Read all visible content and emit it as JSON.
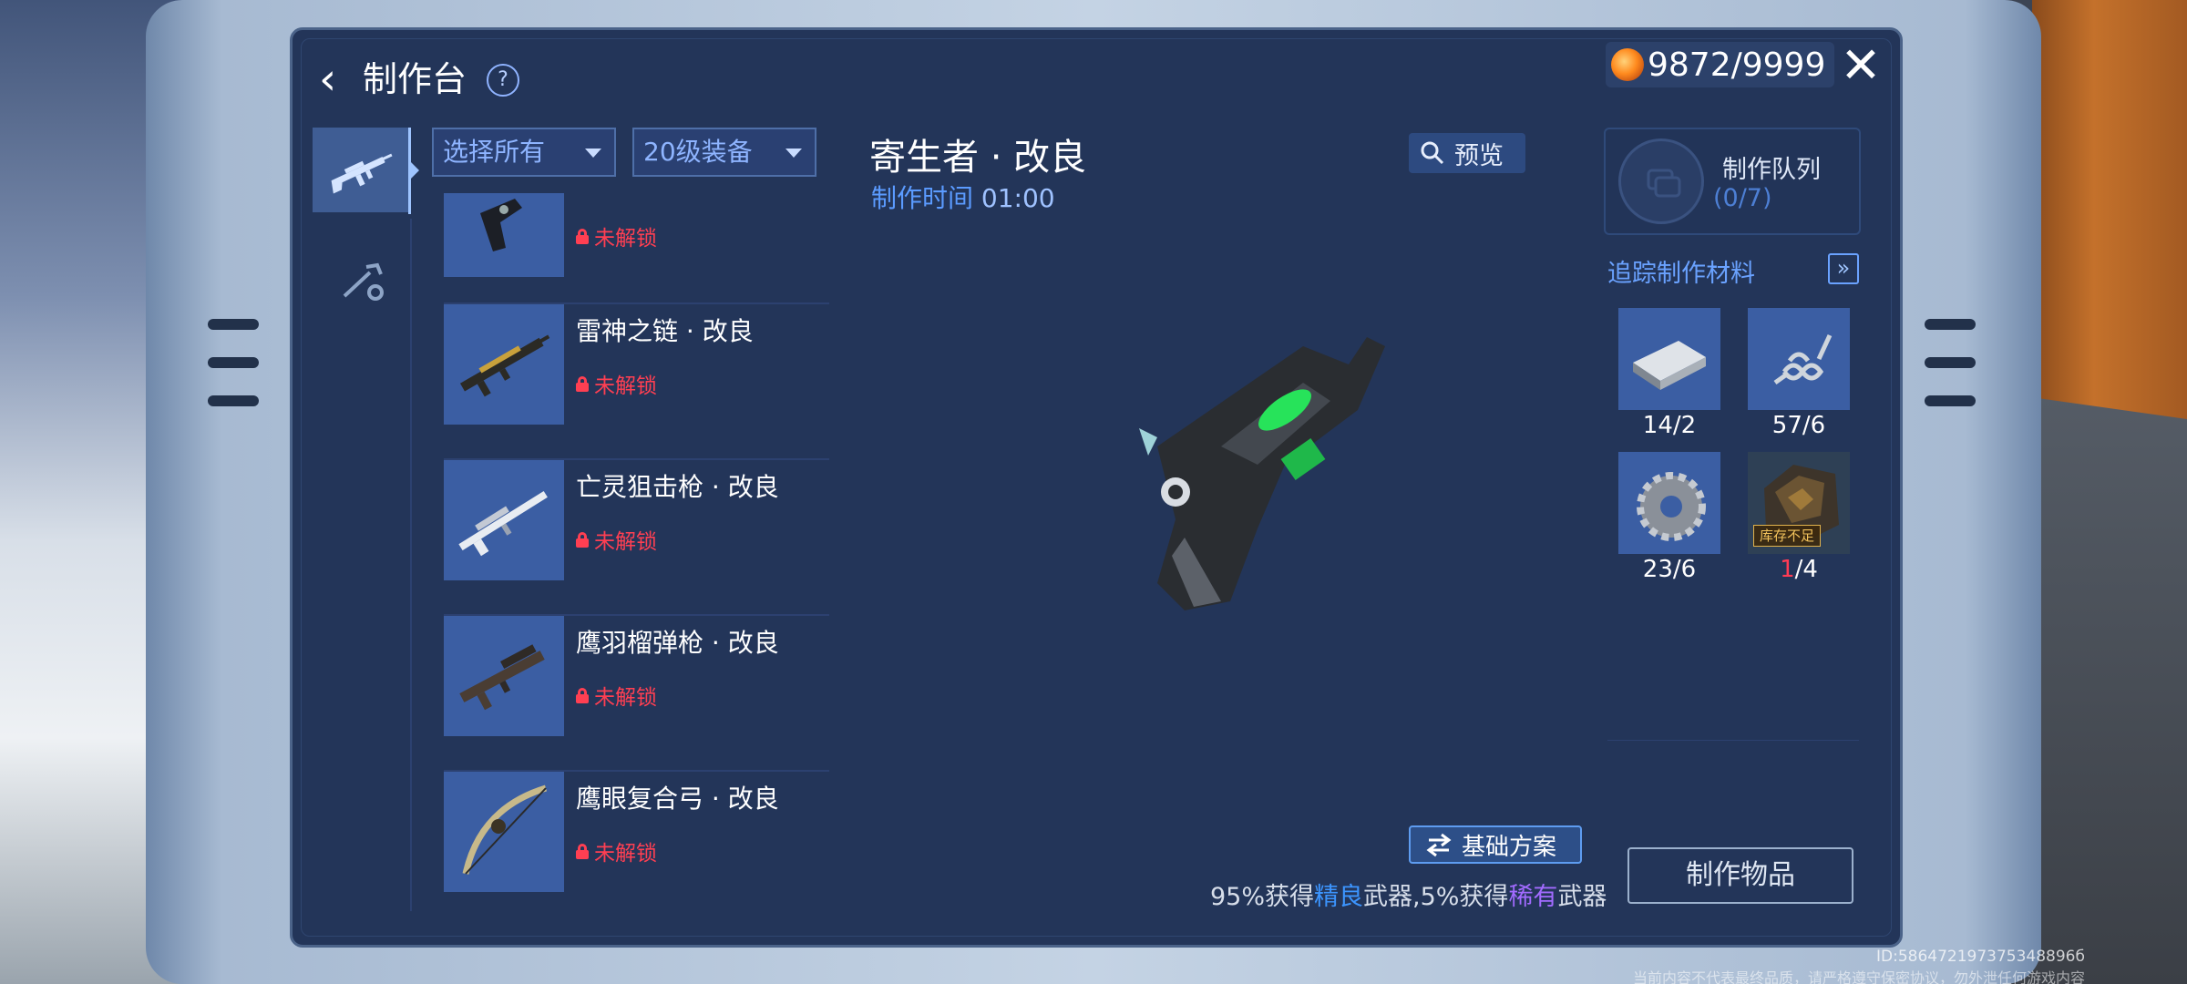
{
  "header": {
    "back_icon": "chevron-left-icon",
    "title": "制作台",
    "help": "?",
    "currency_icon": "energy-coin-icon",
    "currency": "9872/9999",
    "close_icon": "close-icon"
  },
  "categories": [
    {
      "icon": "rifle-icon",
      "selected": true
    },
    {
      "icon": "tools-icon",
      "selected": false
    }
  ],
  "filters": {
    "type": "选择所有",
    "level": "20级装备"
  },
  "items": [
    {
      "name": "",
      "status": "未解锁",
      "icon": "pistol-icon"
    },
    {
      "name": "雷神之链 · 改良",
      "status": "未解锁",
      "icon": "assault-rifle-icon"
    },
    {
      "name": "亡灵狙击枪 · 改良",
      "status": "未解锁",
      "icon": "sniper-rifle-icon"
    },
    {
      "name": "鹰羽榴弹枪 · 改良",
      "status": "未解锁",
      "icon": "grenade-launcher-icon"
    },
    {
      "name": "鹰眼复合弓 · 改良",
      "status": "未解锁",
      "icon": "compound-bow-icon"
    }
  ],
  "detail": {
    "name": "寄生者 · 改良",
    "time_label": "制作时间",
    "time_value": "01:00",
    "preview": "预览",
    "weapon_icon": "parasite-pistol-icon"
  },
  "queue": {
    "title": "制作队列",
    "count": "(0/7)"
  },
  "tracking": {
    "title": "追踪制作材料",
    "button": "»"
  },
  "materials": [
    {
      "icon": "metal-plate-icon",
      "count": "14/2"
    },
    {
      "icon": "spring-icon",
      "count": "57/6"
    },
    {
      "icon": "gear-icon",
      "count": "23/6"
    },
    {
      "icon": "ore-icon",
      "count_have": "1",
      "count_need": "/4",
      "tag": "库存不足"
    }
  ],
  "plan": {
    "label": "基础方案",
    "icon": "swap-icon"
  },
  "chance": {
    "p1": "95%获得",
    "q1": "精良",
    "p2": "武器,5%获得",
    "q2": "稀有",
    "p3": "武器"
  },
  "make_button": "制作物品",
  "footer": {
    "id": "ID:586472197375348896б",
    "disclaimer": "当前内容不代表最终品质，请严格遵守保密协议，勿外泄任何游戏内容"
  }
}
